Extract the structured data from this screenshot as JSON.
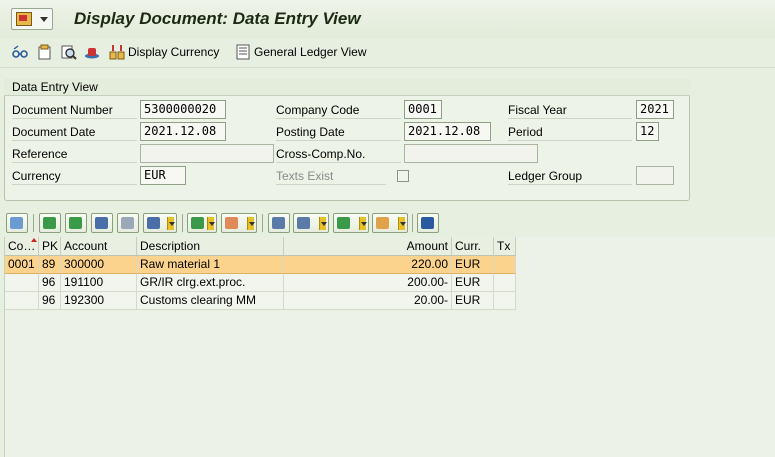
{
  "window": {
    "title": "Display Document: Data Entry View"
  },
  "toolbar": {
    "icons": [
      "glasses-icon",
      "page-icon",
      "magnify-icon",
      "hat-icon",
      "display-currency-icon",
      "ledger-icon"
    ],
    "display_currency_label": "Display Currency",
    "general_ledger_label": "General Ledger View"
  },
  "header": {
    "group_title": "Data Entry View",
    "document_number": {
      "label": "Document Number",
      "value": "5300000020"
    },
    "company_code": {
      "label": "Company Code",
      "value": "0001"
    },
    "fiscal_year": {
      "label": "Fiscal Year",
      "value": "2021"
    },
    "document_date": {
      "label": "Document Date",
      "value": "2021.12.08"
    },
    "posting_date": {
      "label": "Posting Date",
      "value": "2021.12.08"
    },
    "period": {
      "label": "Period",
      "value": "12"
    },
    "reference": {
      "label": "Reference",
      "value": ""
    },
    "cross_comp": {
      "label": "Cross-Comp.No.",
      "value": ""
    },
    "currency": {
      "label": "Currency",
      "value": "EUR"
    },
    "texts_exist": {
      "label": "Texts Exist",
      "checked": false
    },
    "ledger_group": {
      "label": "Ledger Group",
      "value": ""
    }
  },
  "grid": {
    "columns": [
      "Co…",
      "PK",
      "Account",
      "Description",
      "Amount",
      "Curr.",
      "Tx"
    ],
    "rows": [
      {
        "co": "0001",
        "pk": "89",
        "account": "300000",
        "description": "Raw material 1",
        "amount": "220.00",
        "curr": "EUR",
        "tx": "",
        "selected": true
      },
      {
        "co": "",
        "pk": "96",
        "account": "191100",
        "description": "GR/IR clrg.ext.proc.",
        "amount": "200.00-",
        "curr": "EUR",
        "tx": "",
        "selected": false
      },
      {
        "co": "",
        "pk": "96",
        "account": "192300",
        "description": "Customs clearing MM",
        "amount": "20.00-",
        "curr": "EUR",
        "tx": "",
        "selected": false
      }
    ]
  },
  "colors": {
    "selected_row": "#fcd38c",
    "background": "#e7efe0"
  }
}
